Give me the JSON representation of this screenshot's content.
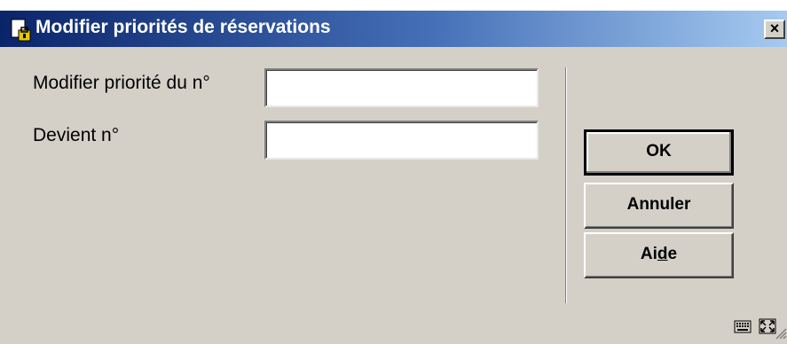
{
  "window": {
    "title": "Modifier priorités de réservations",
    "close_label": "×"
  },
  "form": {
    "priority_label": "Modifier priorité du n°",
    "priority_value": "",
    "becomes_label": "Devient n°",
    "becomes_value": ""
  },
  "buttons": {
    "ok": "OK",
    "cancel": "Annuler",
    "help_pre": "Ai",
    "help_underlined": "d",
    "help_post": "e"
  },
  "status_icons": [
    "keyboard-icon",
    "maximize-icon"
  ],
  "colors": {
    "dialog_bg": "#d4d0c8",
    "titlebar_start": "#0a246a",
    "titlebar_end": "#a6caf0",
    "title_text": "#ffffff"
  }
}
